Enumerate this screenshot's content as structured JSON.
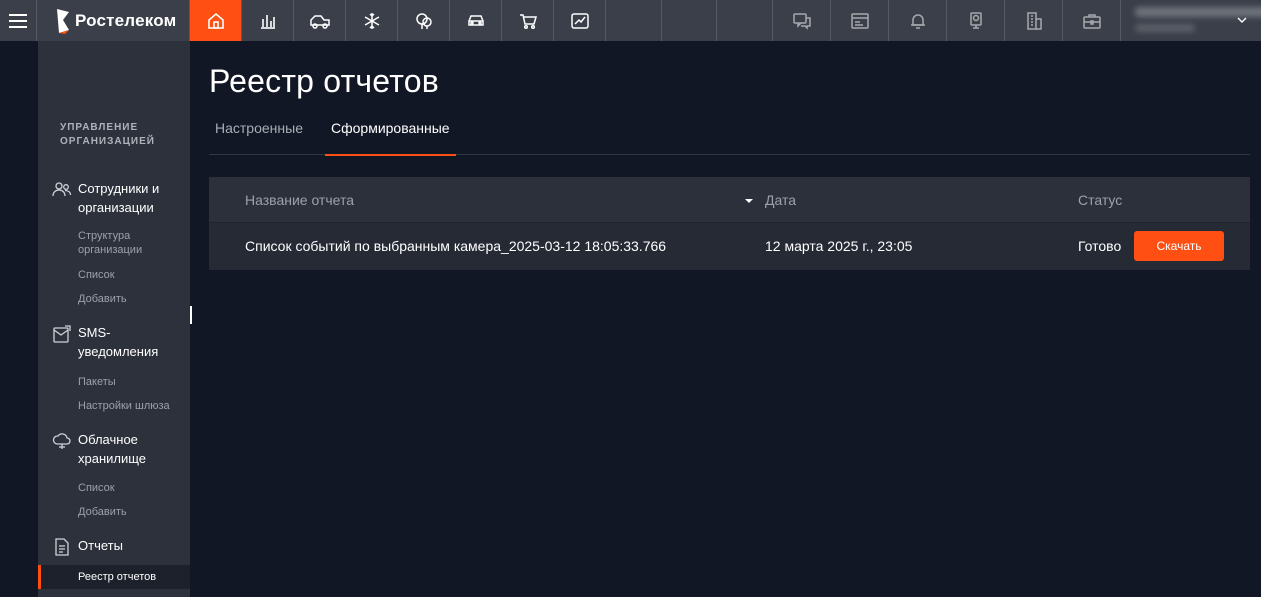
{
  "brand": {
    "name": "Ростелеком"
  },
  "topbar": {
    "nav_icons": [
      "home-icon",
      "bar-chart-icon",
      "truck-icon",
      "snowflake-icon",
      "tree-icon",
      "car-icon",
      "cart-icon",
      "trend-chart-icon"
    ],
    "right_icons": [
      "chat-icon",
      "terminal-icon",
      "bell-icon",
      "camera-icon",
      "building-icon",
      "briefcase-icon"
    ]
  },
  "sidebar": {
    "heading": "УПРАВЛЕНИЕ ОРГАНИЗАЦИЕЙ",
    "groups": [
      {
        "label": "Сотрудники и организации",
        "icon": "users-icon",
        "links": [
          "Структура организации",
          "Список",
          "Добавить"
        ]
      },
      {
        "label": "SMS-уведомления",
        "icon": "sms-icon",
        "links": [
          "Пакеты",
          "Настройки шлюза"
        ]
      },
      {
        "label": "Облачное хранилище",
        "icon": "cloud-icon",
        "links": [
          "Список",
          "Добавить"
        ]
      },
      {
        "label": "Отчеты",
        "icon": "document-icon",
        "links": [
          "Реестр отчетов"
        ]
      }
    ]
  },
  "page": {
    "title": "Реестр отчетов",
    "tabs": [
      {
        "label": "Настроенные",
        "active": false
      },
      {
        "label": "Сформированные",
        "active": true
      }
    ]
  },
  "table": {
    "columns": [
      "Название отчета",
      "Дата",
      "Статус"
    ],
    "rows": [
      {
        "name": "Список событий по выбранным камера_2025-03-12 18:05:33.766",
        "date": "12 марта 2025 г., 23:05",
        "status": "Готово",
        "action": "Скачать"
      }
    ]
  },
  "colors": {
    "accent": "#ff4f12",
    "background": "#121725",
    "sidebar": "#2c313b",
    "topbar": "#3b3f49"
  }
}
